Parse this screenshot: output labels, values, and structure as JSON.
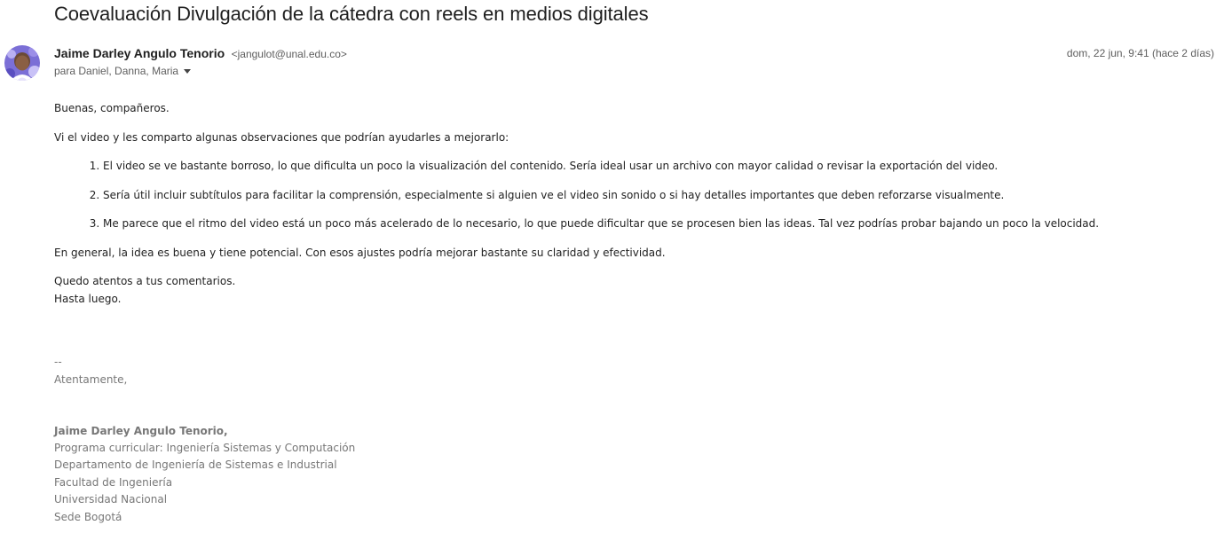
{
  "subject": "Coevaluación Divulgación de la cátedra con reels en medios digitales",
  "sender": {
    "name": "Jaime Darley Angulo Tenorio",
    "email": "<jangulot@unal.edu.co>",
    "avatar_icon": "user-avatar"
  },
  "recipients": "para Daniel, Danna, Maria",
  "date": "dom, 22 jun, 9:41 (hace 2 días)",
  "body": {
    "greeting": "Buenas, compañeros.",
    "intro": "Vi el video y les comparto algunas observaciones que podrían ayudarles a mejorarlo:",
    "points": [
      "El video se ve bastante borroso, lo que dificulta un poco la visualización del contenido. Sería ideal usar un archivo con mayor calidad o revisar la exportación del video.",
      "Sería útil incluir subtítulos para facilitar la comprensión, especialmente si alguien ve el video sin sonido o si hay detalles importantes que deben reforzarse visualmente.",
      "Me parece que el ritmo del video está un poco más acelerado de lo necesario, lo que puede dificultar que se procesen bien las ideas. Tal vez podrías probar bajando un poco la velocidad."
    ],
    "summary": "En general, la idea es buena y tiene potencial. Con esos ajustes podría mejorar bastante su claridad y efectividad.",
    "closing_1": "Quedo atentos a tus comentarios.",
    "closing_2": "Hasta luego."
  },
  "signature": {
    "dash": "--",
    "salutation": "Atentamente,",
    "name": "Jaime Darley Angulo Tenorio,",
    "lines": [
      "Programa curricular: Ingeniería Sistemas y Computación",
      "Departamento de Ingeniería de Sistemas e Industrial",
      "Facultad de Ingeniería",
      "Universidad Nacional",
      "Sede Bogotá"
    ]
  }
}
